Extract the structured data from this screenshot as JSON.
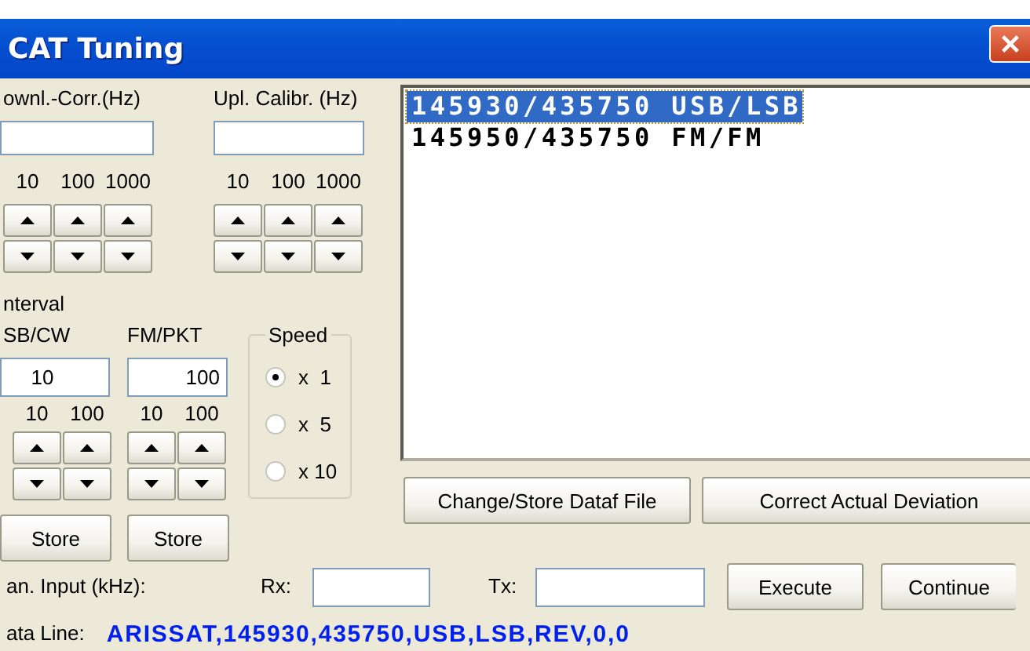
{
  "window": {
    "title": "CAT Tuning"
  },
  "downlink": {
    "label": "ownl.-Corr.(Hz)",
    "steps": [
      "10",
      "100",
      "1000"
    ]
  },
  "uplink": {
    "label": "Upl. Calibr. (Hz)",
    "steps": [
      "10",
      "100",
      "1000"
    ]
  },
  "interval": {
    "label": "nterval",
    "modes": [
      {
        "label": "SB/CW",
        "value": "10",
        "steps": [
          "10",
          "100"
        ],
        "store": "Store"
      },
      {
        "label": "FM/PKT",
        "value": "100",
        "steps": [
          "10",
          "100"
        ],
        "store": "Store"
      }
    ]
  },
  "speed": {
    "label": "Speed",
    "options": [
      {
        "label": "x  1",
        "selected": true
      },
      {
        "label": "x  5",
        "selected": false
      },
      {
        "label": "x 10",
        "selected": false
      }
    ]
  },
  "list": {
    "items": [
      {
        "text": "145930/435750 USB/LSB",
        "selected": true
      },
      {
        "text": "145950/435750 FM/FM",
        "selected": false
      }
    ]
  },
  "list_buttons": [
    "Change/Store Dataf File",
    "Correct Actual Deviation"
  ],
  "manual": {
    "label": "an. Input (kHz):",
    "rx_label": "Rx:",
    "tx_label": "Tx:",
    "buttons": [
      "Execute",
      "Continue"
    ]
  },
  "data_line": {
    "label": "ata Line:",
    "value": "ARISSAT,145930,435750,USB,LSB,REV,0,0"
  }
}
